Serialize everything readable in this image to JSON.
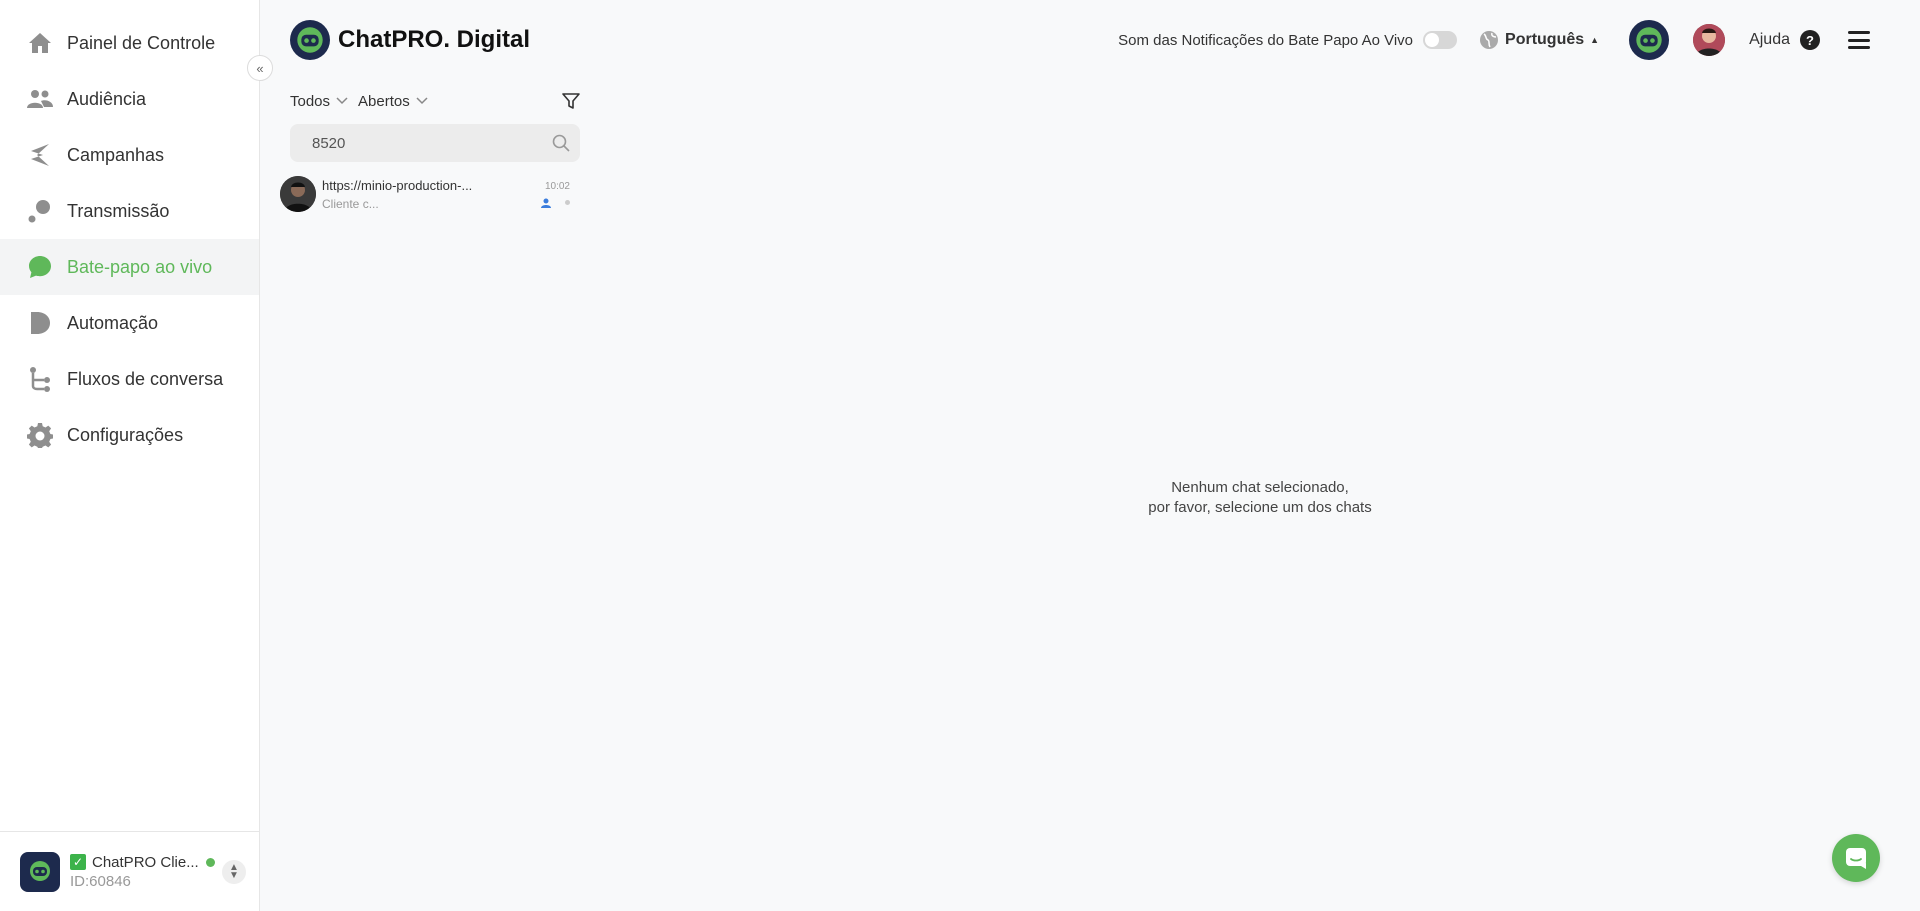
{
  "sidebar": {
    "items": [
      {
        "label": "Painel de Controle",
        "icon": "home-icon"
      },
      {
        "label": "Audiência",
        "icon": "users-icon"
      },
      {
        "label": "Campanhas",
        "icon": "campaign-icon"
      },
      {
        "label": "Transmissão",
        "icon": "broadcast-icon"
      },
      {
        "label": "Bate-papo ao vivo",
        "icon": "chat-icon",
        "active": true
      },
      {
        "label": "Automação",
        "icon": "automation-icon"
      },
      {
        "label": "Fluxos de conversa",
        "icon": "flow-icon"
      },
      {
        "label": "Configurações",
        "icon": "gear-icon"
      }
    ],
    "account": {
      "name": "ChatPRO Clie...",
      "id": "ID:60846"
    }
  },
  "header": {
    "brand": "ChatPRO. Digital",
    "notif_label": "Som das Notificações do Bate Papo Ao Vivo",
    "language": "Português",
    "help_label": "Ajuda"
  },
  "chatlist": {
    "filter_all": "Todos",
    "filter_status": "Abertos",
    "search_value": "8520",
    "chats": [
      {
        "title": "https://minio-production-...",
        "subtitle": "Cliente c...",
        "time": "10:02"
      }
    ]
  },
  "empty_state": {
    "line1": "Nenhum chat selecionado,",
    "line2": "por favor, selecione um dos chats"
  },
  "colors": {
    "accent": "#5fb85a",
    "navy": "#1d2a4d"
  }
}
